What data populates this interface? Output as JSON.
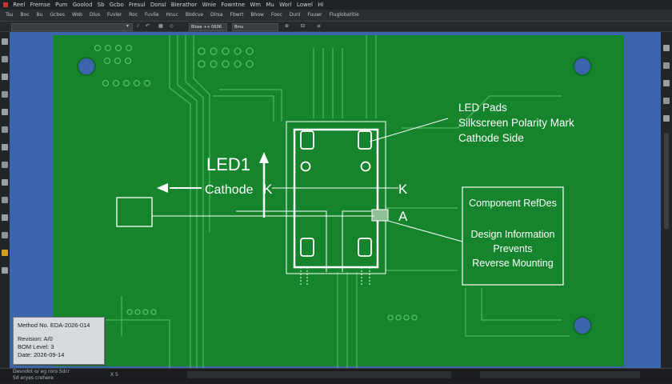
{
  "menubar": {
    "items": [
      "Reel",
      "Fremse",
      "Pum",
      "Goolod",
      "Sb",
      "Gcbo",
      "Fresul",
      "Donsl",
      "Bierathor",
      "Wnie",
      "Fowntne",
      "Wm",
      "Mu",
      "Worl",
      "Lowel",
      "Hi"
    ]
  },
  "toolbar": {
    "items": [
      "Tsu",
      "Boc",
      "Bu",
      "Gcbes",
      "Wob",
      "Dlus",
      "Fuvler",
      "Roc",
      "Fuvlie",
      "Hnuc",
      "Bbdcve",
      "Dlrsa",
      "Fbwrt",
      "Bhow",
      "Fooc",
      "Dunl",
      "Fuuwr",
      "Fluglobatitie"
    ],
    "field1": "",
    "field2": "Bloxe ++ 0636",
    "field3": "Bmu"
  },
  "board": {
    "refdes": "LED1",
    "cathode_label": "Cathode",
    "k_label_left": "K",
    "k_label_right": "K",
    "a_label": "A",
    "callout_top": [
      "LED Pads",
      "Silkscreen Polarity Mark",
      "Cathode Side"
    ],
    "callout_box": [
      "Component RefDes",
      "Design Information",
      "Prevents",
      "Reverse Mounting"
    ]
  },
  "titleblock": {
    "method": "Method No. EDA-2026-014",
    "revision": "Revision: A/0",
    "bom": "BOM Level: 3",
    "date": "Date: 2026-09-14"
  },
  "status": {
    "left": "Desndot o/ eg roro Sdcr",
    "left2": "Sd eryes crehere",
    "mid": "X 5"
  },
  "colors": {
    "board_green": "#15842d",
    "outer_blue": "#3b66ae",
    "silkscreen": "#ffffff",
    "trace": "#52c064"
  }
}
